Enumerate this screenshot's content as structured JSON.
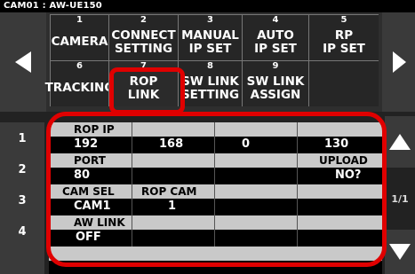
{
  "header": {
    "title": "CAM01 : AW-UE150"
  },
  "menu": [
    {
      "num": "1",
      "line1": "CAMERA",
      "line2": ""
    },
    {
      "num": "2",
      "line1": "CONNECT",
      "line2": "SETTING"
    },
    {
      "num": "3",
      "line1": "MANUAL",
      "line2": "IP SET"
    },
    {
      "num": "4",
      "line1": "AUTO",
      "line2": "IP SET"
    },
    {
      "num": "5",
      "line1": "RP",
      "line2": "IP SET"
    },
    {
      "num": "6",
      "line1": "TRACKING",
      "line2": ""
    },
    {
      "num": "7",
      "line1": "ROP",
      "line2": "LINK"
    },
    {
      "num": "8",
      "line1": "SW LINK",
      "line2": "SETTING"
    },
    {
      "num": "9",
      "line1": "SW LINK",
      "line2": "ASSIGN"
    },
    {
      "num": "",
      "line1": "",
      "line2": ""
    }
  ],
  "rows": [
    {
      "num": "1",
      "cells": [
        {
          "top": "ROP IP",
          "bot": "192"
        },
        {
          "top": "",
          "bot": "168"
        },
        {
          "top": "",
          "bot": "0"
        },
        {
          "top": "",
          "bot": "130"
        }
      ]
    },
    {
      "num": "2",
      "cells": [
        {
          "top": "PORT",
          "bot": "80"
        },
        {
          "top": "",
          "bot": ""
        },
        {
          "top": "",
          "bot": ""
        },
        {
          "top": "UPLOAD",
          "bot": "NO?"
        }
      ]
    },
    {
      "num": "3",
      "cells": [
        {
          "top": "CAM SEL",
          "bot": "CAM1"
        },
        {
          "top": "ROP CAM",
          "bot": "1"
        },
        {
          "top": "",
          "bot": ""
        },
        {
          "top": "",
          "bot": ""
        }
      ]
    },
    {
      "num": "4",
      "cells": [
        {
          "top": "AW LINK",
          "bot": "OFF"
        },
        {
          "top": "",
          "bot": ""
        },
        {
          "top": "",
          "bot": ""
        },
        {
          "top": "",
          "bot": ""
        }
      ]
    }
  ],
  "page_indicator": "1/1",
  "icons": {
    "prev": "triangle-left-icon",
    "next": "triangle-right-icon",
    "scroll_up": "triangle-up-icon",
    "scroll_down": "triangle-down-icon"
  },
  "colors": {
    "highlight": "#e00000",
    "value_label_bg": "#c9c9c9"
  }
}
